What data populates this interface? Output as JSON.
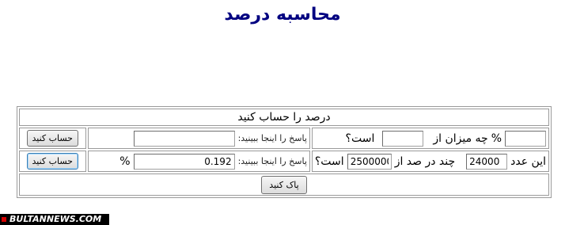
{
  "page": {
    "title": "محاسبه درصد"
  },
  "calculator": {
    "header": "درصد را حساب کنید",
    "row1": {
      "percent_value": "",
      "percent_sign": "%",
      "label_how_much": "چه میزان از",
      "of_value": "",
      "label_is": "است؟",
      "result_label": "پاسخ را اینجا ببینید:",
      "result_value": "",
      "button_label": "حساب کنید"
    },
    "row2": {
      "label_this_number": "این عدد",
      "number_value": "24000",
      "label_what_percent": "چند در صد از",
      "of_value": "2500000",
      "label_is": "است؟",
      "result_label": "پاسخ را اینجا ببینید:",
      "result_value": "0.192",
      "percent_sign": "%",
      "button_label": "حساب کنید"
    },
    "clear_button_label": "پاک کنید"
  },
  "watermark": {
    "text": "BULTANNEWS.COM"
  }
}
